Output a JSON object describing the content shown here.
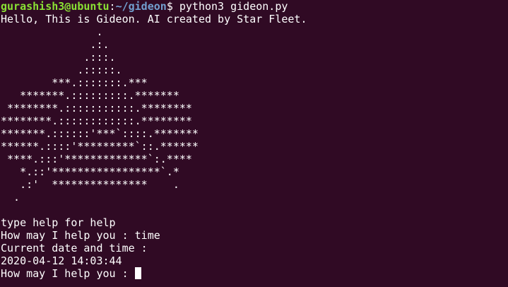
{
  "prompt": {
    "user_host": "gurashish3@ubuntu",
    "separator": ":",
    "path": "~/gideon",
    "symbol": "$ ",
    "command": "python3 gideon.py"
  },
  "greeting": "Hello, This is Gideon. AI created by Star Fleet.",
  "ascii_art": [
    "               .",
    "              .:.",
    "             .:::.",
    "            .:::::.",
    "        ***.:::::::.***",
    "   *******.:::::::::.*******",
    " ********.:::::::::::.********",
    "********.::::::::::::.********",
    "*******.::::::'***`::::.*******",
    "******.::::'*********`::.******",
    " ****.:::'*************`:.****",
    "   *.::'*****************`.*",
    "   .:'  ***************    .",
    "  ."
  ],
  "output": {
    "help_hint": "type help for help",
    "query1_prompt": "How may I help you : ",
    "query1_input": "time",
    "datetime_label": "Current date and time :",
    "datetime_value": "2020-04-12 14:03:44",
    "query2_prompt": "How may I help you : "
  }
}
